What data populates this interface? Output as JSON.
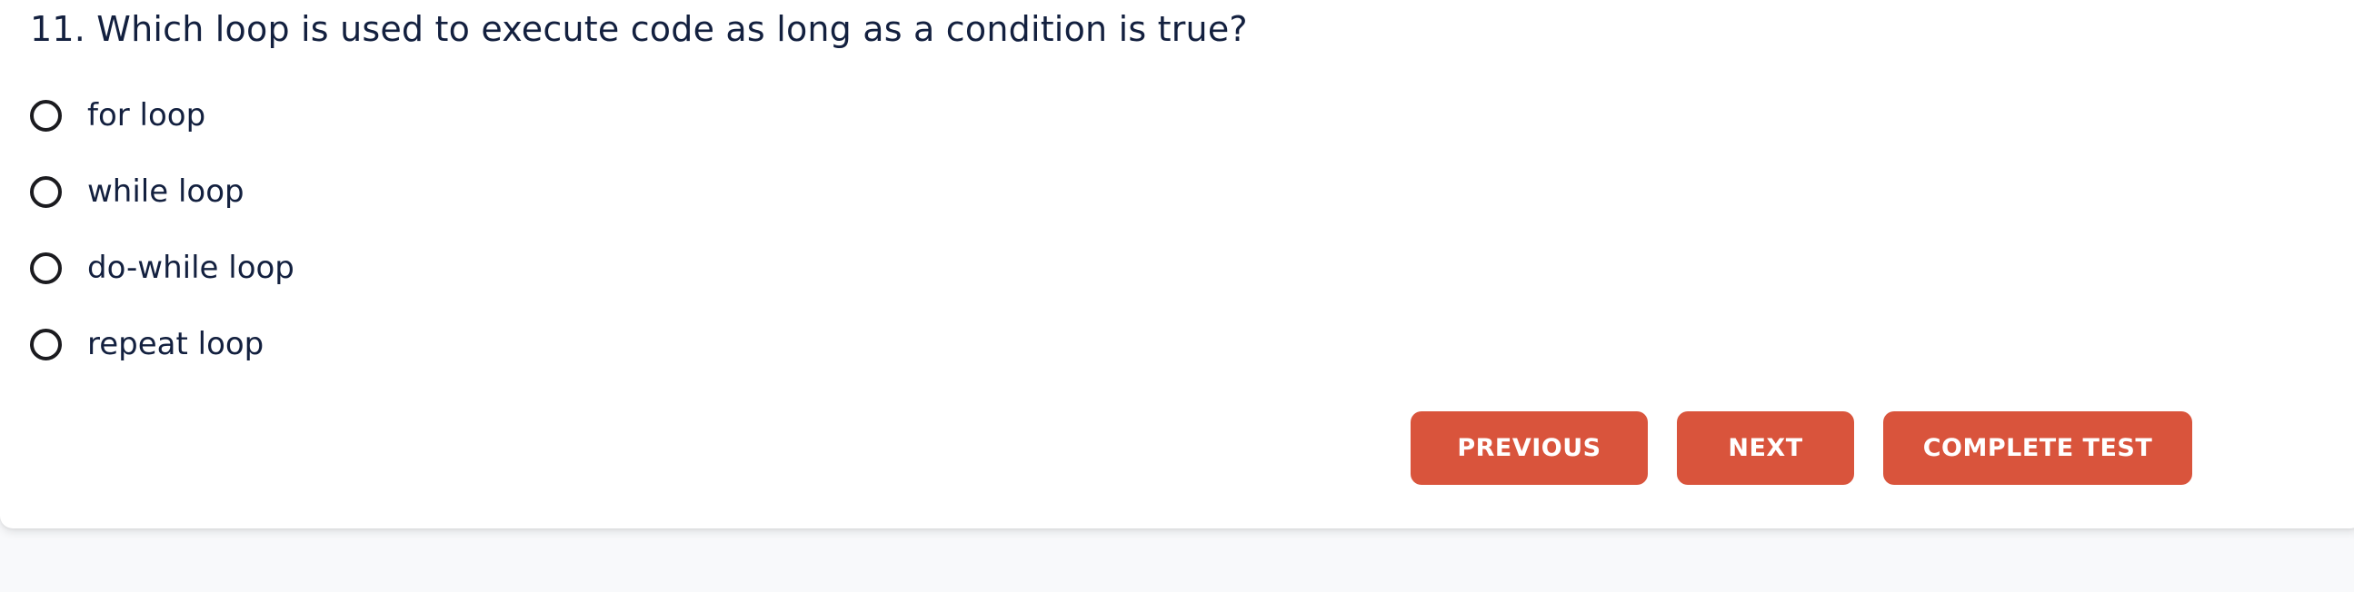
{
  "question": {
    "title": "11. Which loop is used to execute code as long as a condition is true?",
    "options": [
      {
        "label": "for loop"
      },
      {
        "label": "while loop"
      },
      {
        "label": "do-while loop"
      },
      {
        "label": "repeat loop"
      }
    ]
  },
  "actions": {
    "previous_label": "PREVIOUS",
    "next_label": "NEXT",
    "complete_label": "COMPLETE TEST"
  },
  "colors": {
    "accent": "#d9543c",
    "text": "#13203f",
    "page_bg": "#f8f9fb",
    "card_bg": "#ffffff"
  }
}
